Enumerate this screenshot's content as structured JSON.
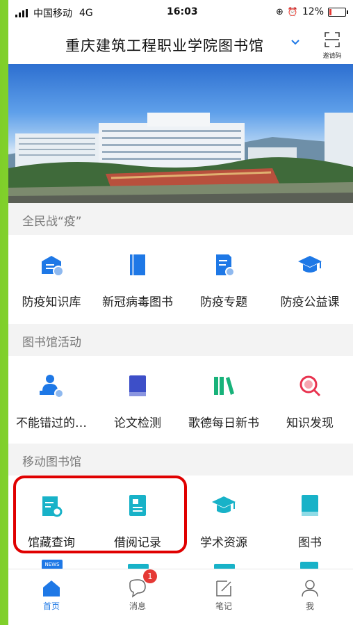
{
  "status_bar": {
    "carrier": "中国移动",
    "network": "4G",
    "time": "16:03",
    "battery": "12%"
  },
  "header": {
    "title": "重庆建筑工程职业学院图书馆",
    "invite_label": "邀请码"
  },
  "sections": [
    {
      "title": "全民战“疫”",
      "items": [
        {
          "label": "防疫知识库",
          "icon": "knowledge-base-icon",
          "color": "#1e78e6"
        },
        {
          "label": "新冠病毒图书",
          "icon": "book-icon",
          "color": "#1e78e6"
        },
        {
          "label": "防疫专题",
          "icon": "topic-doc-icon",
          "color": "#1e78e6"
        },
        {
          "label": "防疫公益课",
          "icon": "graduation-cap-icon",
          "color": "#1e78e6"
        }
      ]
    },
    {
      "title": "图书馆活动",
      "items": [
        {
          "label": "不能错过的…",
          "icon": "lecturer-icon",
          "color": "#1e78e6"
        },
        {
          "label": "论文检测",
          "icon": "book-icon",
          "color": "#3d4fc8"
        },
        {
          "label": "歌德每日新书",
          "icon": "bookshelf-icon",
          "color": "#18b27a"
        },
        {
          "label": "知识发现",
          "icon": "search-discover-icon",
          "color": "#e8334f"
        }
      ]
    },
    {
      "title": "移动图书馆",
      "items": [
        {
          "label": "馆藏查询",
          "icon": "catalog-search-icon",
          "color": "#18b2c8"
        },
        {
          "label": "借阅记录",
          "icon": "borrow-record-icon",
          "color": "#18b2c8"
        },
        {
          "label": "学术资源",
          "icon": "graduation-cap-icon",
          "color": "#18b2c8"
        },
        {
          "label": "图书",
          "icon": "book-icon",
          "color": "#18b2c8"
        }
      ]
    }
  ],
  "partial_row": [
    {
      "label": "NEWS",
      "icon": "news-icon"
    }
  ],
  "tabbar": [
    {
      "label": "首页",
      "icon": "home-icon",
      "active": true
    },
    {
      "label": "消息",
      "icon": "message-icon",
      "badge": "1"
    },
    {
      "label": "笔记",
      "icon": "note-icon"
    },
    {
      "label": "我",
      "icon": "profile-icon"
    }
  ]
}
